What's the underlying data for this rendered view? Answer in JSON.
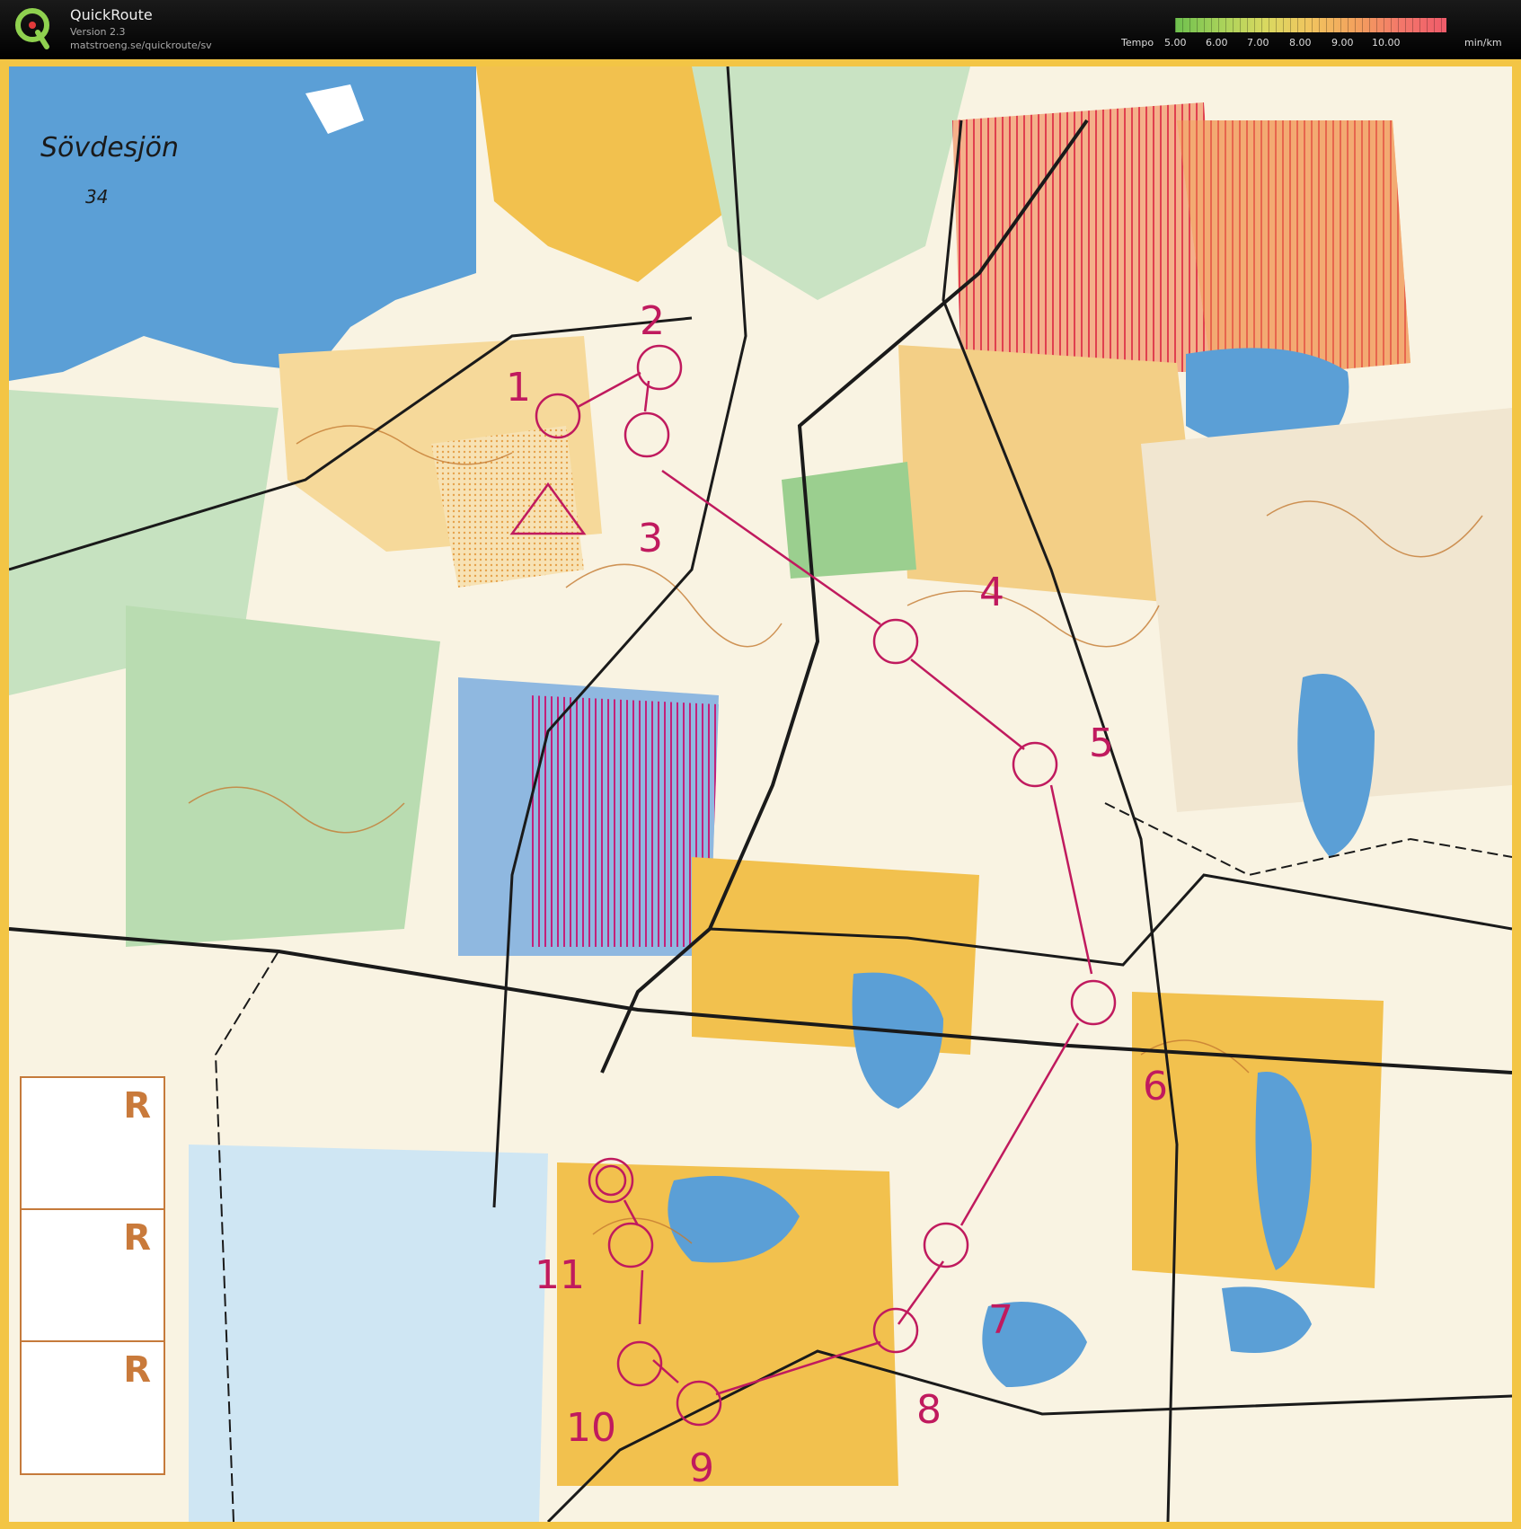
{
  "app": {
    "title": "QuickRoute",
    "version": "Version 2.3",
    "url": "matstroeng.se/quickroute/sv"
  },
  "legend": {
    "label": "Tempo",
    "unit": "min/km",
    "ticks": [
      "5.00",
      "6.00",
      "7.00",
      "8.00",
      "9.00",
      "10.00"
    ],
    "colors": [
      "#6ec04e",
      "#a7d25a",
      "#d9d960",
      "#f1c45f",
      "#f3a15d",
      "#f3776a",
      "#ef5b6a"
    ]
  },
  "map": {
    "lake_name": "Sövdesjön",
    "lake_elevation": "34",
    "controls": [
      "1",
      "2",
      "3",
      "4",
      "5",
      "6",
      "7",
      "8",
      "9",
      "10",
      "11"
    ],
    "r_box_labels": [
      "R",
      "R",
      "R"
    ],
    "colors": {
      "water": "#5b9fd6",
      "open_land": "#f2c14e",
      "forest_green": "#8cc98a",
      "contour": "#c47a32",
      "course": "#c01a5e",
      "road": "#1a1a1a"
    }
  }
}
